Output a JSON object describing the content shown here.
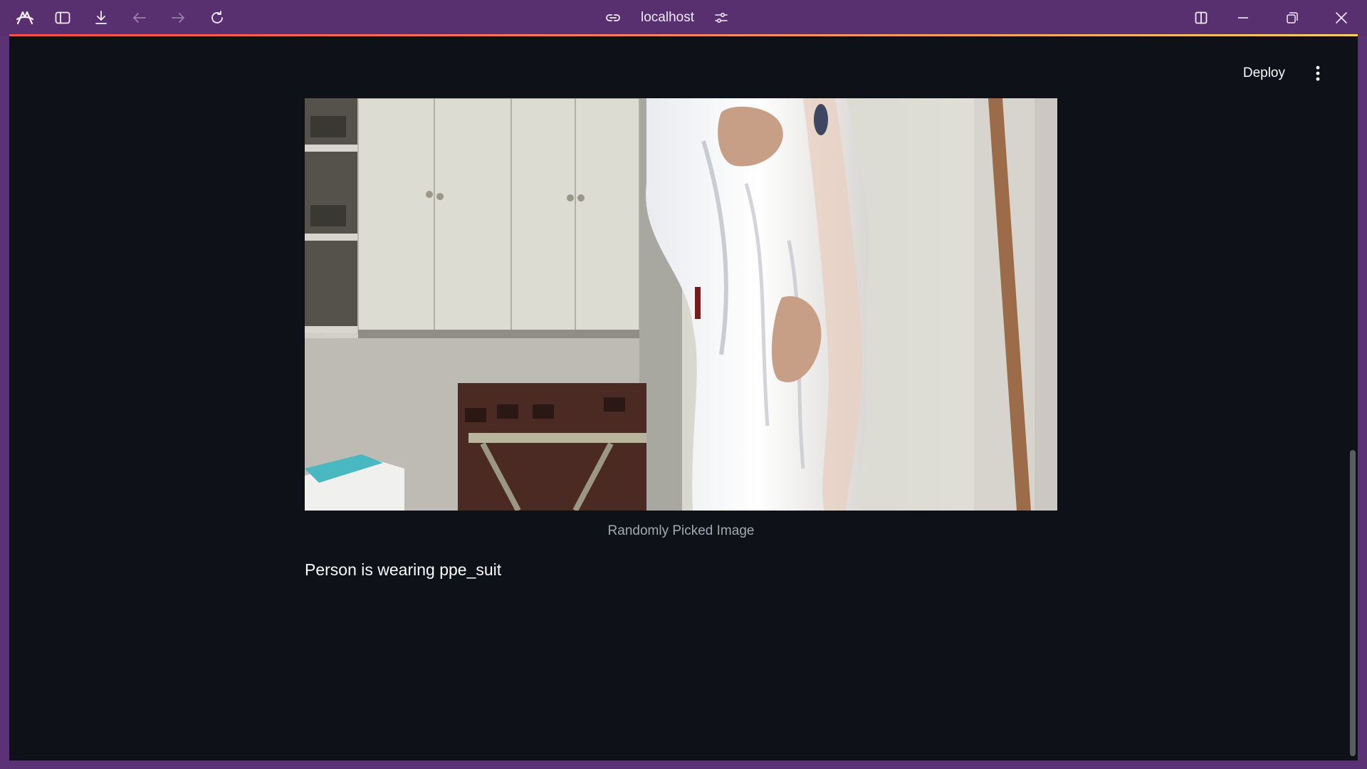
{
  "browser": {
    "url": "localhost",
    "icons": {
      "logo": "arc-logo-icon",
      "sidebar": "sidebar-toggle-icon",
      "download": "download-icon",
      "back": "arrow-left-icon",
      "forward": "arrow-right-icon",
      "reload": "reload-icon",
      "link": "link-icon",
      "site_settings": "sliders-icon",
      "split_view": "split-view-icon",
      "minimize": "minimize-icon",
      "restore": "restore-icon",
      "close": "close-icon"
    },
    "colors": {
      "frame": "#58306f",
      "accent_start": "#ff4b4b",
      "accent_end": "#ffd166"
    }
  },
  "app": {
    "deploy_label": "Deploy",
    "menu_icon": "kebab-menu-icon",
    "image": {
      "caption": "Randomly Picked Image",
      "alt": "photo of a person in a white protective suit"
    },
    "result": "Person is wearing ppe_suit",
    "colors": {
      "background": "#0e1117",
      "text": "#fafafa",
      "caption": "#a3a8b4"
    }
  }
}
